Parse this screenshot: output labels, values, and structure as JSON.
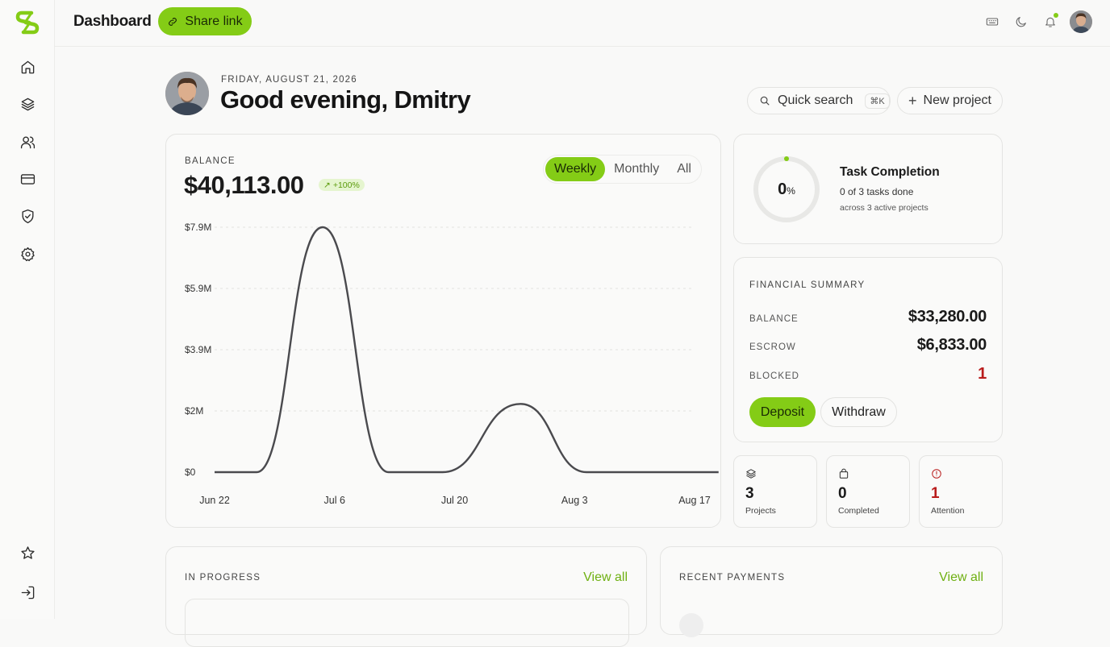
{
  "app": {
    "brand_color": "#84cc16",
    "logo_icon": "lightning-s-logo"
  },
  "sidebar": {
    "items": [
      {
        "name": "home",
        "icon": "home-icon"
      },
      {
        "name": "layers",
        "icon": "layers-icon"
      },
      {
        "name": "users",
        "icon": "users-icon"
      },
      {
        "name": "billing",
        "icon": "credit-card-icon"
      },
      {
        "name": "security",
        "icon": "shield-check-icon"
      },
      {
        "name": "settings",
        "icon": "gear-icon"
      }
    ],
    "bottom_items": [
      {
        "name": "favorites",
        "icon": "star-icon"
      },
      {
        "name": "logout",
        "icon": "logout-icon"
      }
    ]
  },
  "header": {
    "title": "Dashboard",
    "share_label": "Share link"
  },
  "welcome": {
    "date": "FRIDAY, AUGUST 21, 2026",
    "greeting": "Good evening, Dmitry"
  },
  "search": {
    "label": "Quick search",
    "shortcut": "⌘K"
  },
  "new_project": {
    "label": "New project"
  },
  "balance": {
    "label": "BALANCE",
    "value": "$40,113.00",
    "change": "+100%",
    "periods": [
      "Weekly",
      "Monthly",
      "All"
    ],
    "active_period": "Weekly"
  },
  "chart_data": {
    "type": "line",
    "x": [
      "Jun 22",
      "Jul 6",
      "Jul 20",
      "Aug 3",
      "Aug 17"
    ],
    "y_ticks": [
      "$0",
      "$2M",
      "$3.9M",
      "$5.9M",
      "$7.9M"
    ],
    "ylim": [
      0,
      7.9
    ],
    "series": [
      {
        "points": [
          [
            0,
            0
          ],
          [
            0.35,
            0
          ],
          [
            0.9,
            7.9
          ],
          [
            1.45,
            0
          ],
          [
            1.9,
            0
          ],
          [
            2.55,
            2.2
          ],
          [
            3.1,
            0
          ],
          [
            4.2,
            0
          ]
        ]
      }
    ],
    "line_color": "#4a4a4e",
    "grid": true
  },
  "tasks": {
    "percent": "0",
    "percent_unit": "%",
    "progress": 0,
    "title": "Task Completion",
    "subtitle": "0 of 3 tasks done",
    "detail": "across 3 active projects"
  },
  "financial": {
    "title": "FINANCIAL SUMMARY",
    "rows": [
      {
        "label": "BALANCE",
        "value": "$33,280.00",
        "status": "normal"
      },
      {
        "label": "ESCROW",
        "value": "$6,833.00",
        "status": "normal"
      },
      {
        "label": "BLOCKED",
        "value": "1",
        "status": "alert"
      }
    ],
    "deposit_label": "Deposit",
    "withdraw_label": "Withdraw"
  },
  "stats": [
    {
      "value": "3",
      "label": "Projects",
      "icon": "layers-icon",
      "color": "#2b2b2b"
    },
    {
      "value": "0",
      "label": "Completed",
      "icon": "bag-icon",
      "color": "#2b2b2b"
    },
    {
      "value": "1",
      "label": "Attention",
      "icon": "alert-circle-icon",
      "color": "#b91c1c"
    }
  ],
  "in_progress": {
    "label": "IN PROGRESS",
    "view_all": "View all"
  },
  "recent_payments": {
    "label": "RECENT PAYMENTS",
    "view_all": "View all"
  }
}
